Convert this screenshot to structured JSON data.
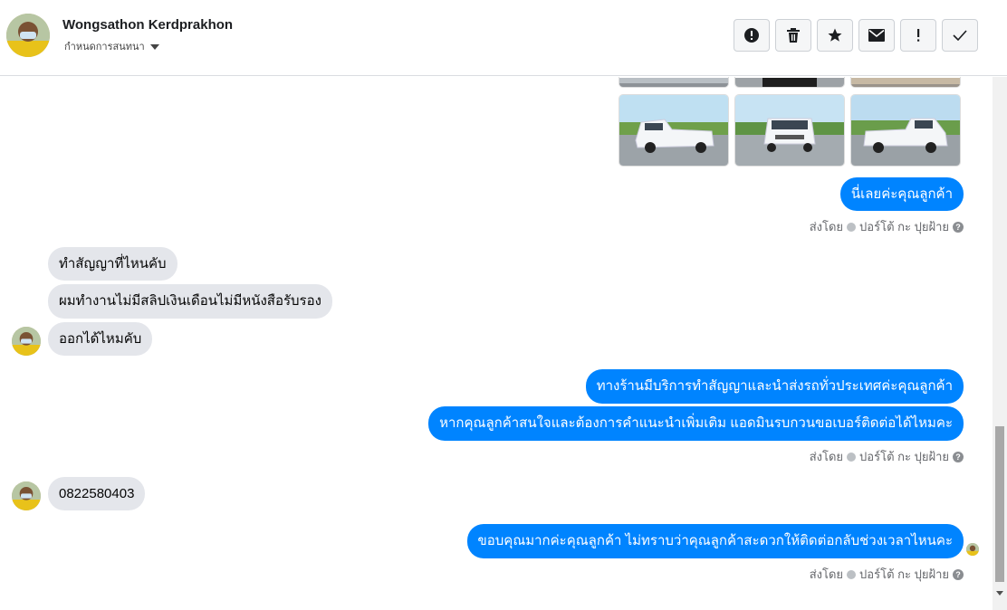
{
  "header": {
    "contact_name": "Wongsathon Kerdprakhon",
    "subtitle": "กำหนดการสนทนา",
    "actions": [
      {
        "name": "report-icon",
        "glyph": "!"
      },
      {
        "name": "trash-icon"
      },
      {
        "name": "star-icon"
      },
      {
        "name": "envelope-icon"
      },
      {
        "name": "exclamation-icon",
        "glyph": "!"
      },
      {
        "name": "checkmark-icon"
      }
    ]
  },
  "messages": {
    "out_1": "นี่เลยค่ะคุณลูกค้า",
    "in_1": "ทำสัญญาที่ไหนคับ",
    "in_2": "ผมทำงานไม่มีสลิปเงินเดือนไม่มีหนังสือรับรอง",
    "in_3": "ออกได้ไหมคับ",
    "out_2": "ทางร้านมีบริการทำสัญญาและนำส่งรถทั่วประเทศค่ะคุณลูกค้า",
    "out_3": "หากคุณลูกค้าสนใจและต้องการคำแนะนำเพิ่มเติม แอดมินรบกวนขอเบอร์ติดต่อได้ไหมคะ",
    "in_4": "0822580403",
    "out_4": "ขอบคุณมากค่ะคุณลูกค้า ไม่ทราบว่าคุณลูกค้าสะดวกให้ติดต่อกลับช่วงเวลาไหนคะ"
  },
  "sent_by": {
    "prefix": "ส่งโดย",
    "agent": "ปอร์โต้ กะ ปุยฝ้าย",
    "help": "?"
  },
  "colors": {
    "outgoing_bubble": "#0084ff",
    "incoming_bubble": "#e4e6eb"
  }
}
